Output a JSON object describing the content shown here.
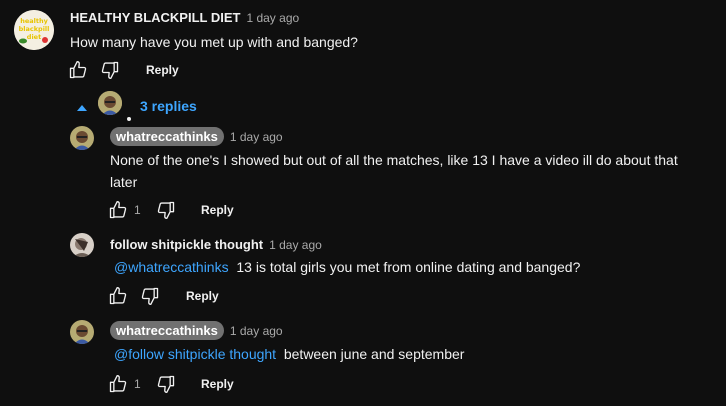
{
  "top_comment": {
    "avatar_text": "Healthy blackpill diet",
    "author": "HEALTHY BLACKPILL DIET",
    "time": "1 day ago",
    "text": "How many have you met up with and banged?",
    "reply_label": "Reply"
  },
  "replies_toggle": {
    "label": "3 replies"
  },
  "replies": [
    {
      "author": "whatreccathinks",
      "time": "1 day ago",
      "text_line1": "None of the one's I showed but out of all the matches, like 13 I have a video ill do about that",
      "text_line2": "later",
      "like_count": "1",
      "reply_label": "Reply"
    },
    {
      "author": "follow shitpickle thought",
      "time": "1 day ago",
      "mention": "@whatreccathinks",
      "text": "13 is total girls you met from online dating and banged?",
      "reply_label": "Reply"
    },
    {
      "author": "whatreccathinks",
      "time": "1 day ago",
      "mention": "@follow shitpickle thought",
      "text": "between june and september",
      "like_count": "1",
      "reply_label": "Reply"
    }
  ],
  "colors": {
    "background": "#0f0f0f",
    "mention": "#3ea6ff",
    "pill": "#717171"
  }
}
